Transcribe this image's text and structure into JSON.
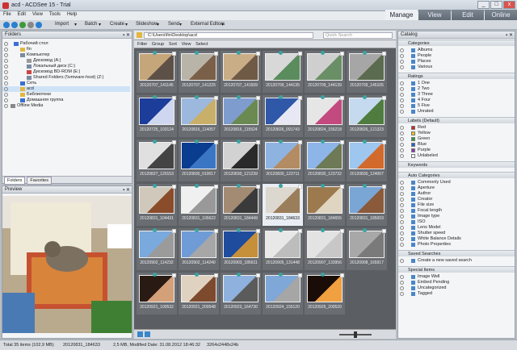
{
  "window": {
    "title": "acd - ACDSee 15 - Trial",
    "min": "_",
    "max": "□",
    "close": "x"
  },
  "menu": [
    "File",
    "Edit",
    "View",
    "Tools",
    "Help"
  ],
  "modes": [
    {
      "label": "Manage",
      "active": true
    },
    {
      "label": "View",
      "active": false
    },
    {
      "label": "Edit",
      "active": false
    },
    {
      "label": "Online",
      "active": false
    }
  ],
  "toolbar": {
    "import": "Import",
    "batch": "Batch",
    "create": "Create",
    "slideshow": "Slideshow",
    "send": "Send",
    "external": "External Editors"
  },
  "folders": {
    "header": "Folders",
    "tree": [
      "Рабочий стол",
      "fin",
      "Компьютер",
      "Дисковод (A:)",
      "Локальный диск (C:)",
      "Дисковод BD-ROM (E:)",
      "Shared Folders (\\\\vmware-host) (Z:)",
      "Сеть",
      "acd",
      "Библиотеки",
      "Домашняя группа",
      "Offline Media"
    ],
    "tabs": [
      "Folders",
      "Favorites"
    ]
  },
  "preview": {
    "header": "Preview"
  },
  "path": {
    "value": "C:\\Users\\fin\\Desktop\\acd",
    "search_placeholder": "Quick Search"
  },
  "filterbar": [
    "Filter",
    "Group",
    "Sort",
    "View",
    "Select"
  ],
  "files": [
    "20120707_141145",
    "20120707_141225",
    "20120707_141509",
    "20120709_144135",
    "20120709_144139",
    "20120709_145105",
    "20120725_103124",
    "20120816_114057",
    "20120816_115524",
    "20120826_091743",
    "20120824_155218",
    "20120826_121323",
    "20120827_120153",
    "20120830_010017",
    "20120830_121239",
    "20120830_123711",
    "20120830_123732",
    "20120830_124007",
    "20120831_104431",
    "20120831_105622",
    "20120831_184449",
    "20120831_184633",
    "20120831_184655",
    "20120831_185003",
    "20120902_114232",
    "20120902_114240",
    "20120903_185611",
    "20120905_131448",
    "20120907_133956",
    "20120908_165917",
    "20120921_100532",
    "20120921_200548",
    "20120923_164730",
    "20120924_155120",
    "20120925_200520"
  ],
  "catalog": {
    "header": "Catalog",
    "categories_title": "Categories",
    "categories": [
      "Albums",
      "People",
      "Places",
      "Various"
    ],
    "ratings_title": "Ratings",
    "ratings": [
      "1  One",
      "2  Two",
      "3  Three",
      "4  Four",
      "5  Five",
      "Unrated"
    ],
    "labels_title": "Labels (Default)",
    "labels": [
      {
        "name": "Red",
        "color": "#cc2222"
      },
      {
        "name": "Yellow",
        "color": "#e6c619"
      },
      {
        "name": "Green",
        "color": "#2e9c3a"
      },
      {
        "name": "Blue",
        "color": "#2462c9"
      },
      {
        "name": "Purple",
        "color": "#8a3aa8"
      },
      {
        "name": "Unlabeled",
        "color": "#ffffff"
      }
    ],
    "keywords_title": "Keywords",
    "auto_title": "Auto Categories",
    "auto": [
      "Commonly Used",
      "Aperture",
      "Author",
      "Creator",
      "File size",
      "Focal length",
      "Image type",
      "ISO",
      "Lens Model",
      "Shutter speed",
      "White Balance Details",
      "Photo Properties"
    ],
    "saved_title": "Saved Searches",
    "saved": [
      "Create a new saved search"
    ],
    "special_title": "Special Items",
    "special": [
      "Image Well",
      "Embed Pending",
      "Uncategorized",
      "Tagged"
    ]
  },
  "status": {
    "total": "Total 35 items (102,9 MB)",
    "selected": "20120831_184633",
    "info": "2,5 MB, Modified Date: 31.08.2012 18:46:32",
    "dims": "3264x2448x24b"
  }
}
